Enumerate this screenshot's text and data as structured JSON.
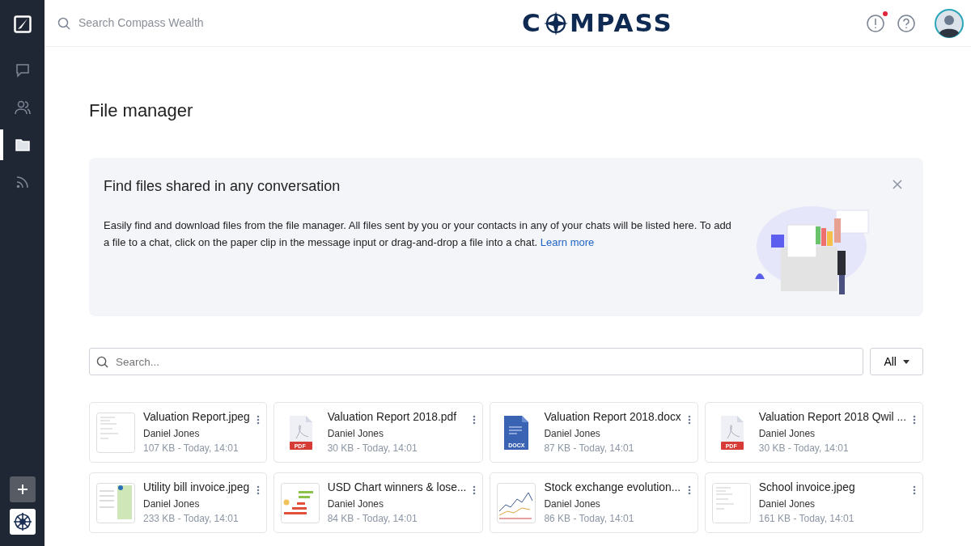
{
  "sidebar": {
    "items": [
      {
        "kind": "chat",
        "selected": false
      },
      {
        "kind": "contacts",
        "selected": false
      },
      {
        "kind": "files",
        "selected": true
      },
      {
        "kind": "feed",
        "selected": false
      }
    ]
  },
  "header": {
    "search": {
      "placeholder": "Search Compass Wealth"
    },
    "logo": {
      "before": "C",
      "after": "MPASS"
    },
    "alerts": {
      "unread": true
    }
  },
  "page": {
    "title": "File manager"
  },
  "banner": {
    "title": "Find files shared in any conversation",
    "text": "Easily find and download files from the file manager. All files sent by you or your contacts in any of your chats will be listed here. To add a file to a chat, click on the paper clip in the message input or drag-and-drop a file into a chat.",
    "link": "Learn more"
  },
  "filter": {
    "search": {
      "placeholder": "Search..."
    },
    "dropdown": "All"
  },
  "files": [
    {
      "name": "Valuation Report.jpeg",
      "owner": "Daniel Jones",
      "meta": "107 KB - Today, 14:01"
    },
    {
      "kind": "pdf",
      "name": "Valuation Report 2018.pdf",
      "owner": "Daniel Jones",
      "meta": "30 KB - Today, 14:01",
      "badge": "PDF"
    },
    {
      "kind": "docx",
      "name": "Valuation Report 2018.docx",
      "owner": "Daniel Jones",
      "meta": "87 KB - Today, 14:01",
      "badge": "DOCX"
    },
    {
      "kind": "pdf",
      "name": "Valuation Report 2018 Qwil ...",
      "owner": "Daniel Jones",
      "meta": "30 KB - Today, 14:01",
      "badge": "PDF"
    },
    {
      "name": "Utility bill invoice.jpeg",
      "owner": "Daniel Jones",
      "meta": "233 KB - Today, 14:01"
    },
    {
      "name": "USD Chart winners & lose...",
      "owner": "Daniel Jones",
      "meta": "84 KB - Today, 14:01"
    },
    {
      "name": "Stock exchange evolution...",
      "owner": "Daniel Jones",
      "meta": "86 KB - Today, 14:01"
    },
    {
      "name": "School invoice.jpeg",
      "owner": "Daniel Jones",
      "meta": "161 KB - Today, 14:01"
    }
  ]
}
